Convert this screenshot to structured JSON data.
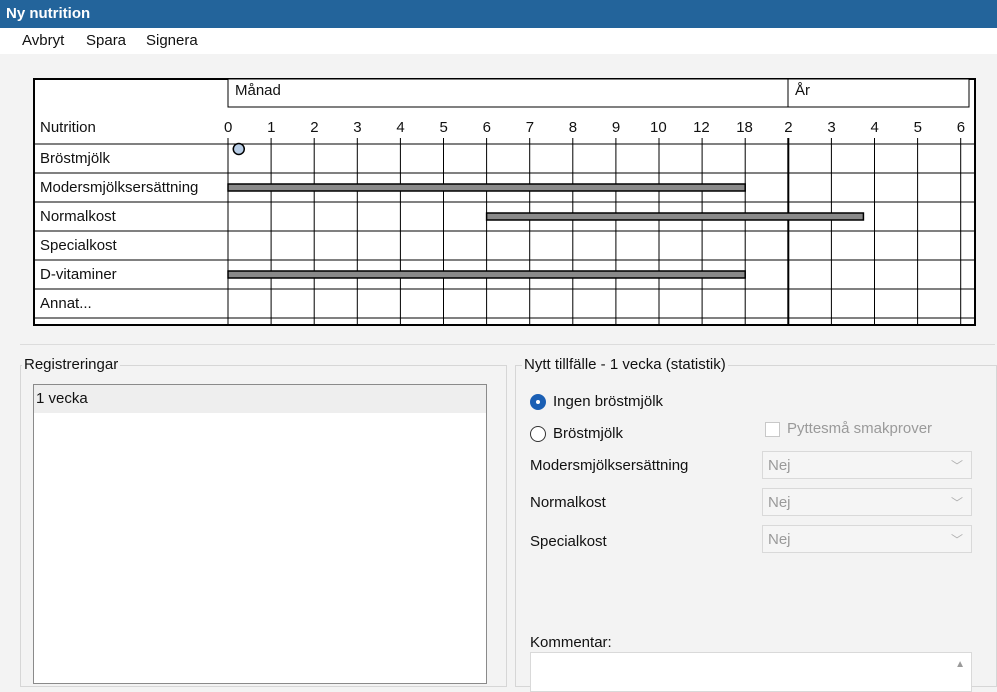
{
  "window": {
    "title": "Ny nutrition"
  },
  "menu": {
    "cancel": "Avbryt",
    "save": "Spara",
    "sign": "Signera"
  },
  "chart": {
    "header_month": "Månad",
    "header_year": "År",
    "column_header": "Nutrition",
    "month_ticks": [
      "0",
      "1",
      "2",
      "3",
      "4",
      "5",
      "6",
      "7",
      "8",
      "9",
      "10",
      "12",
      "18"
    ],
    "year_ticks": [
      "2",
      "3",
      "4",
      "5",
      "6"
    ],
    "rows": [
      "Bröstmjölk",
      "Modersmjölksersättning",
      "Normalkost",
      "Specialkost",
      "D-vitaminer",
      "Annat..."
    ],
    "bars": [
      {
        "row": 1,
        "from": "0 mån",
        "to": "18 mån"
      },
      {
        "row": 2,
        "from": "6 mån",
        "to": "3.75 år"
      },
      {
        "row": 4,
        "from": "0 mån",
        "to": "18 mån"
      }
    ],
    "markers": [
      {
        "row": 0,
        "at": "0.25 mån"
      }
    ]
  },
  "registrations": {
    "title": "Registreringar",
    "items": [
      "1 vecka"
    ]
  },
  "new_occasion": {
    "title": "Nytt tillfälle - 1 vecka (statistik)",
    "radio_none": "Ingen bröstmjölk",
    "radio_breast": "Bröstmjölk",
    "checkbox_tiny": "Pyttesmå smakprover",
    "field_formula": "Modersmjölksersättning",
    "field_normal": "Normalkost",
    "field_special": "Specialkost",
    "val_formula": "Nej",
    "val_normal": "Nej",
    "val_special": "Nej",
    "comment_label": "Kommentar:"
  },
  "colors": {
    "titlebar": "#23649b",
    "bar_fill": "#8a8a8a",
    "marker": "#b8cde6",
    "radio_selected": "#1a5fb4"
  }
}
